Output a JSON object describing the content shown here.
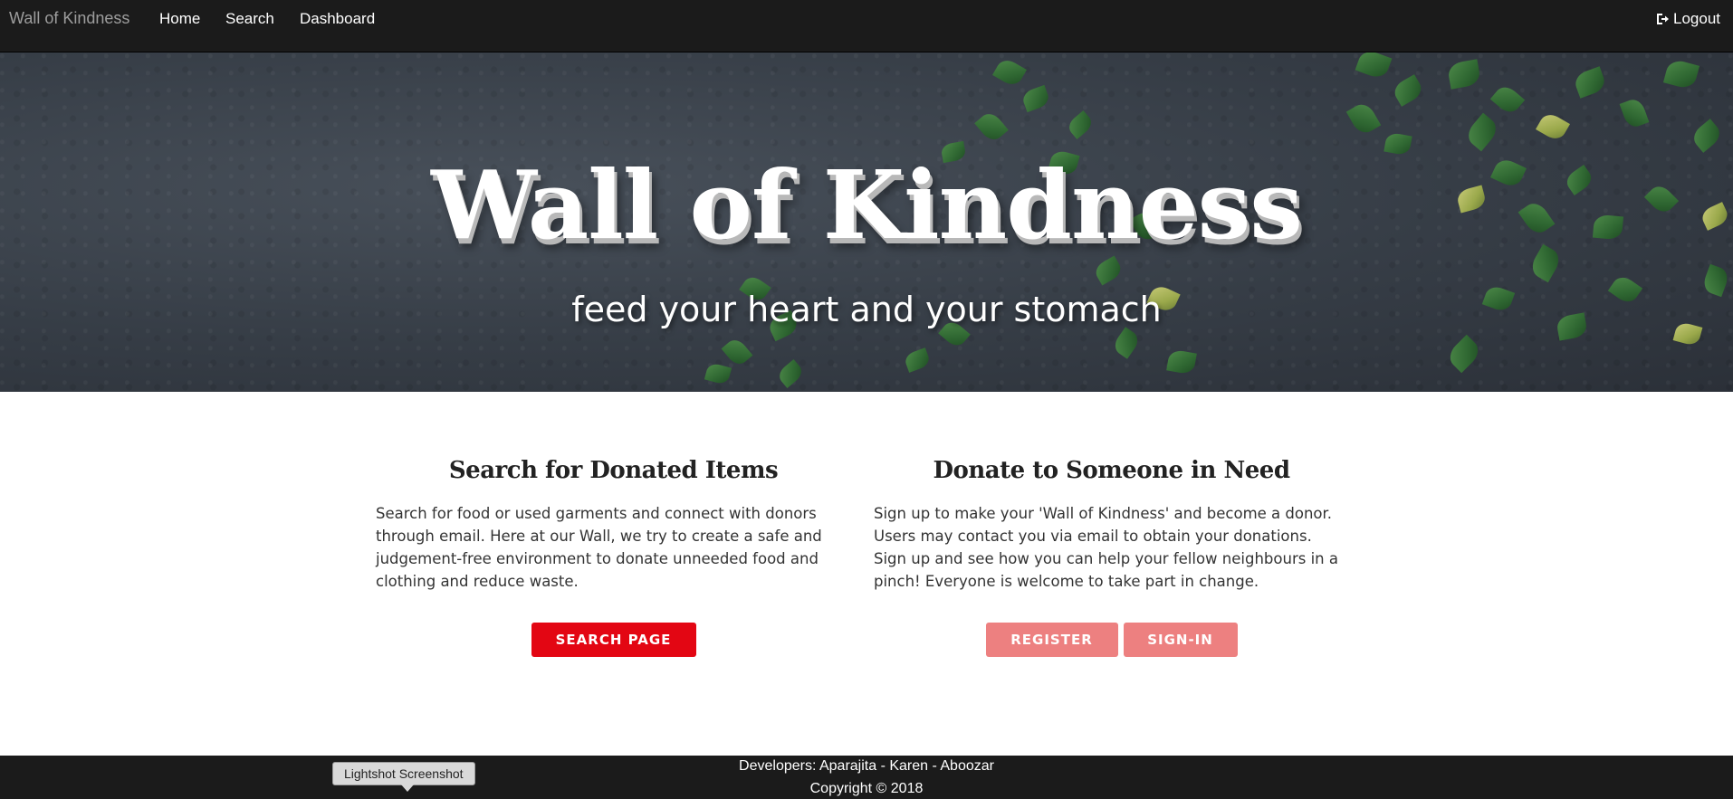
{
  "navbar": {
    "brand": "Wall of Kindness",
    "links": [
      "Home",
      "Search",
      "Dashboard"
    ],
    "logout_label": "Logout"
  },
  "hero": {
    "title": "Wall of Kindness",
    "subtitle": "feed your heart and your stomach"
  },
  "search_section": {
    "heading": "Search for Donated Items",
    "body": "Search for food or used garments and connect with donors through email. Here at our Wall, we try to create a safe and judgement-free environment to donate unneeded food and clothing and reduce waste.",
    "button": "SEARCH PAGE"
  },
  "donate_section": {
    "heading": "Donate to Someone in Need",
    "body": "Sign up to make your 'Wall of Kindness' and become a donor. Users may contact you via email to obtain your donations. Sign up and see how you can help your fellow neighbours in a pinch! Everyone is welcome to take part in change.",
    "register_button": "REGISTER",
    "signin_button": "SIGN-IN"
  },
  "footer": {
    "developers": "Developers: Aparajita - Karen - Aboozar",
    "copyright": "Copyright © 2018"
  },
  "tooltip": "Lightshot Screenshot",
  "colors": {
    "navbar_bg": "#1b1b1b",
    "primary_button": "#e30613",
    "secondary_button": "#ed8080"
  },
  "icons": {
    "logout": "logout-icon"
  }
}
